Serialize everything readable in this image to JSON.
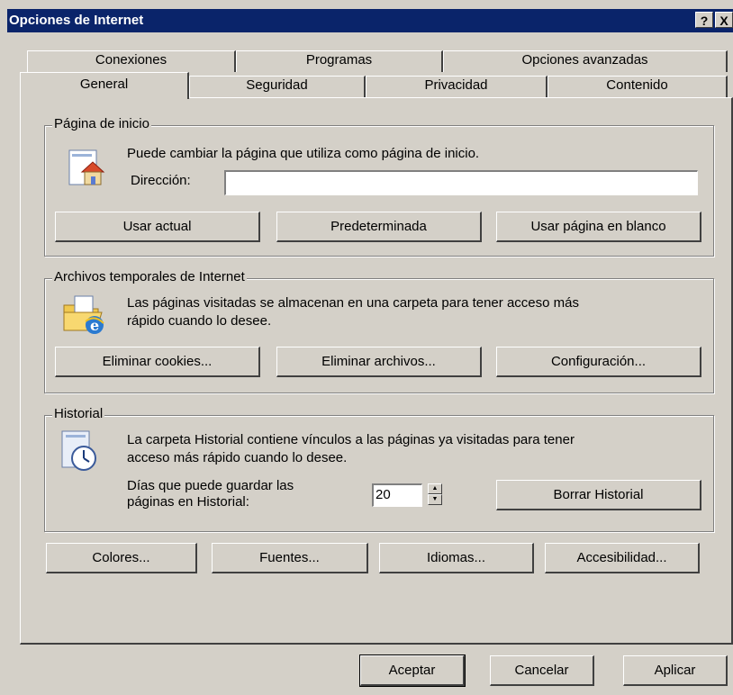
{
  "window": {
    "title": "Opciones de Internet",
    "help_button": "?",
    "close_button": "X"
  },
  "tabs_row1": [
    "Conexiones",
    "Programas",
    "Opciones avanzadas"
  ],
  "tabs_row2": [
    "General",
    "Seguridad",
    "Privacidad",
    "Contenido"
  ],
  "active_tab": "General",
  "home_page": {
    "legend": "Página de inicio",
    "description": "Puede cambiar la página que utiliza como página de inicio.",
    "address_label": "Dirección:",
    "address_value": "",
    "btn_current": "Usar actual",
    "btn_default": "Predeterminada",
    "btn_blank": "Usar página en blanco"
  },
  "temp_files": {
    "legend": "Archivos temporales de Internet",
    "description_line1": "Las páginas visitadas se almacenan en una carpeta para tener acceso más",
    "description_line2": "rápido cuando lo desee.",
    "btn_cookies": "Eliminar cookies...",
    "btn_files": "Eliminar archivos...",
    "btn_settings": "Configuración..."
  },
  "history": {
    "legend": "Historial",
    "description_line1": "La carpeta Historial contiene vínculos a las páginas ya visitadas para tener",
    "description_line2": "acceso más rápido cuando lo desee.",
    "days_label_line1": "Días que puede guardar las",
    "days_label_line2": "páginas en Historial:",
    "days_value": "20",
    "btn_clear": "Borrar Historial"
  },
  "bottom_buttons": {
    "colors": "Colores...",
    "fonts": "Fuentes...",
    "languages": "Idiomas...",
    "accessibility": "Accesibilidad..."
  },
  "dialog_buttons": {
    "ok": "Aceptar",
    "cancel": "Cancelar",
    "apply": "Aplicar"
  },
  "colors": {
    "titlebar": "#0a246a",
    "face": "#d4d0c8"
  }
}
